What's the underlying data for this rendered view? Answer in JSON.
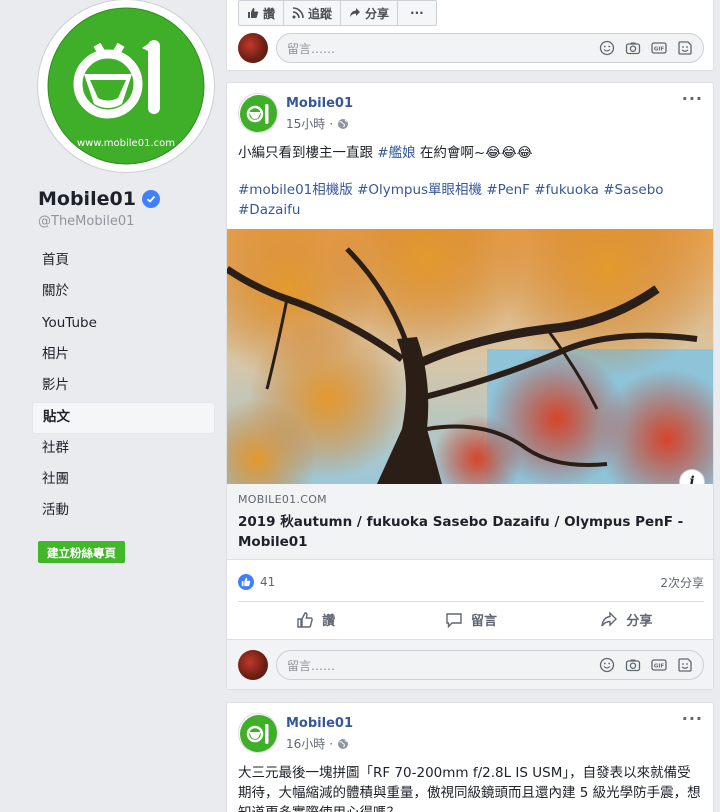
{
  "page": {
    "name": "Mobile01",
    "handle": "@TheMobile01",
    "logo_url_text": "www.mobile01.com"
  },
  "nav": {
    "items": [
      {
        "label": "首頁"
      },
      {
        "label": "關於"
      },
      {
        "label": "YouTube"
      },
      {
        "label": "相片"
      },
      {
        "label": "影片"
      },
      {
        "label": "貼文"
      },
      {
        "label": "社群"
      },
      {
        "label": "社團"
      },
      {
        "label": "活動"
      }
    ],
    "active": "貼文",
    "create_button": "建立粉絲專頁"
  },
  "previous_post": {
    "actions": {
      "like": "讚",
      "follow": "追蹤",
      "share": "分享",
      "more": "···"
    },
    "comment_placeholder": "留言……"
  },
  "post1": {
    "author": "Mobile01",
    "time": "15小時",
    "text_prefix": "小編只看到樓主一直跟 ",
    "text_tag": "#艦娘",
    "text_suffix": " 在約會啊~😂😂😂",
    "hashtags": "#mobile01相機版 #Olympus單眼相機 #PenF #fukuoka #Sasebo #Dazaifu",
    "link_domain": "MOBILE01.COM",
    "link_title": "2019 秋autumn / fukuoka Sasebo Dazaifu / Olympus PenF - Mobile01",
    "like_count": "41",
    "share_count": "2次分享",
    "actions": {
      "like": "讚",
      "comment": "留言",
      "share": "分享"
    },
    "comment_placeholder": "留言……",
    "info_icon": "i"
  },
  "post2": {
    "author": "Mobile01",
    "time": "16小時",
    "text": "大三元最後一塊拼圖「RF 70-200mm f/2.8L IS USM」，自發表以來就備受期待，大幅縮減的體積與重量，傲視同級鏡頭而且還內建 5 級光學防手震，想知道更多實際使用心得嗎？"
  },
  "colors": {
    "brand_green": "#3fae29",
    "link_blue": "#365899",
    "verified_blue": "#4080ff",
    "create_green": "#42b72a"
  }
}
